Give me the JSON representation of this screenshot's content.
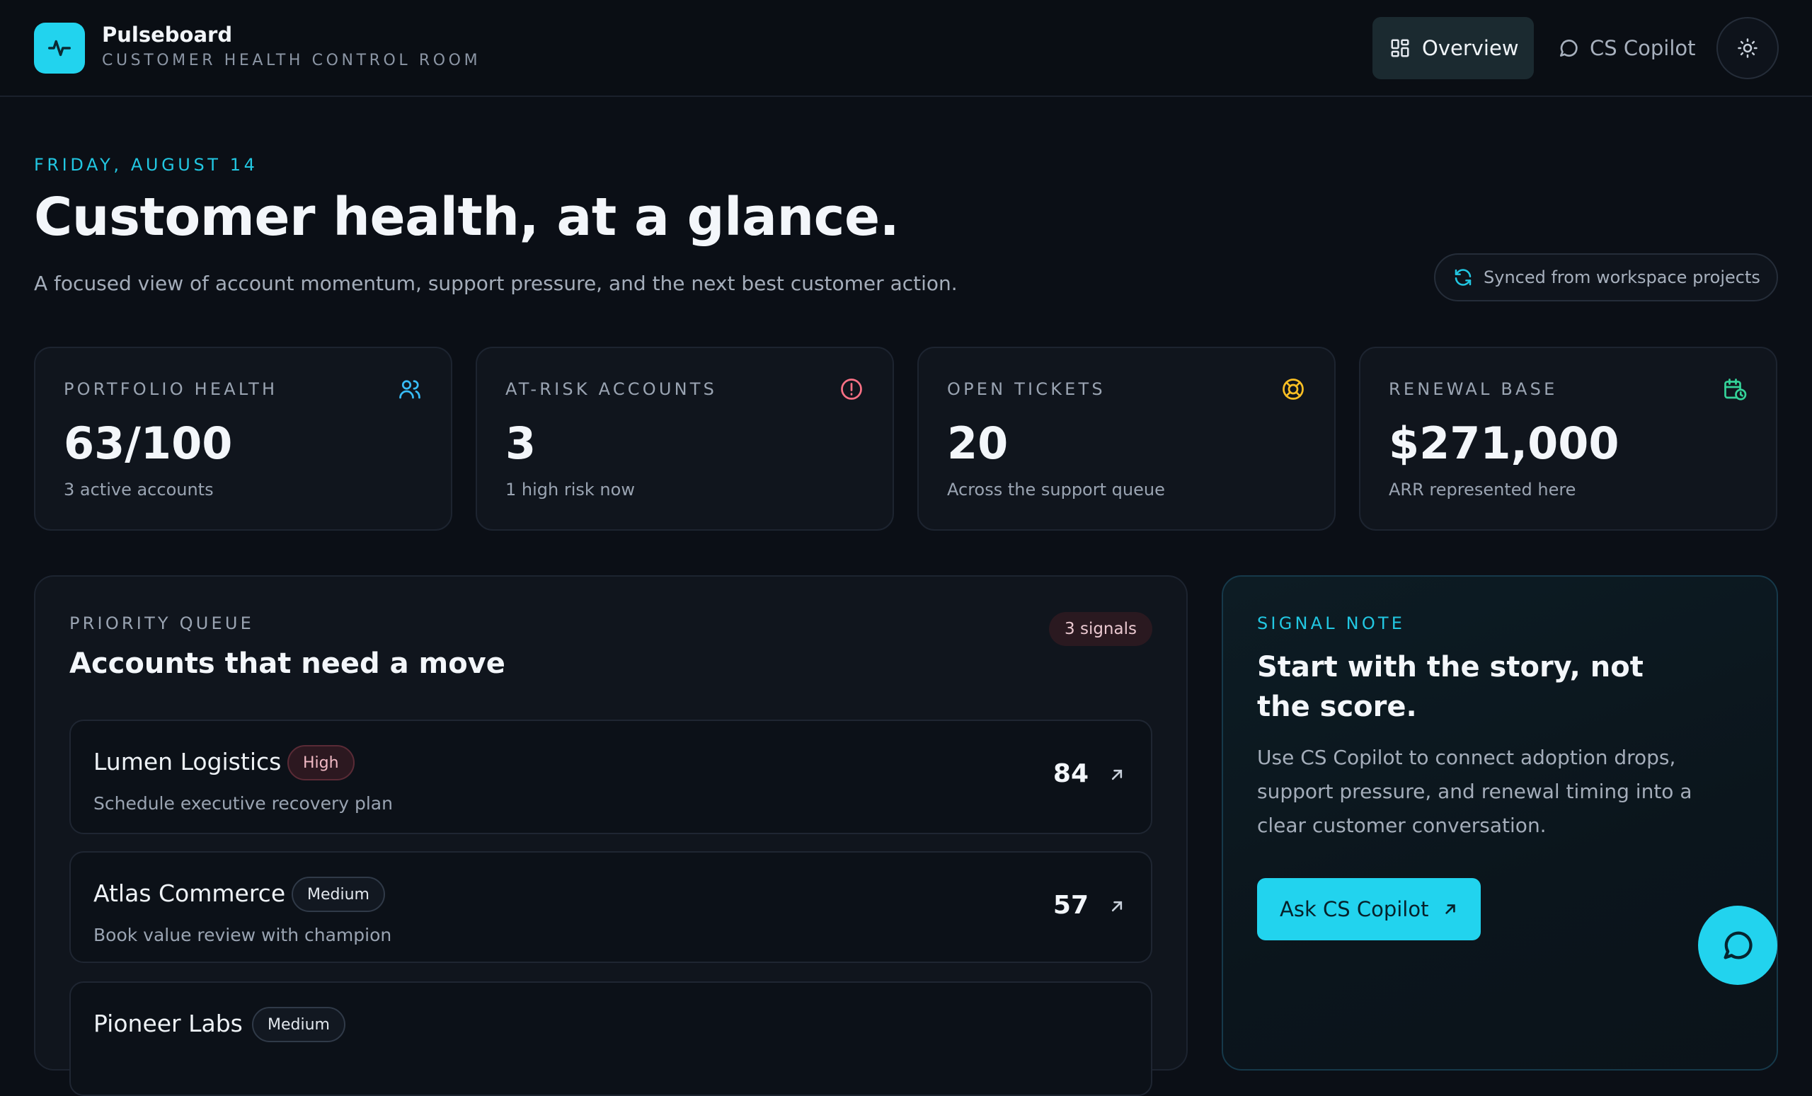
{
  "brand": {
    "name": "Pulseboard",
    "subtitle": "CUSTOMER HEALTH CONTROL ROOM"
  },
  "nav": {
    "overview_label": "Overview",
    "copilot_label": "CS Copilot"
  },
  "hero": {
    "date": "FRIDAY, AUGUST 14",
    "title": "Customer health, at a glance.",
    "subtitle": "A focused view of account momentum, support pressure, and the next best customer action.",
    "sync_label": "Synced from workspace projects"
  },
  "stats": [
    {
      "label": "PORTFOLIO HEALTH",
      "value": "63/100",
      "note": "3 active accounts",
      "icon": "users-icon",
      "color": "#38bdf8"
    },
    {
      "label": "AT-RISK ACCOUNTS",
      "value": "3",
      "note": "1 high risk now",
      "icon": "alert-circle-icon",
      "color": "#fb7185"
    },
    {
      "label": "OPEN TICKETS",
      "value": "20",
      "note": "Across the support queue",
      "icon": "lifebuoy-icon",
      "color": "#fbbf24"
    },
    {
      "label": "RENEWAL BASE",
      "value": "$271,000",
      "note": "ARR represented here",
      "icon": "calendar-clock-icon",
      "color": "#34d399"
    }
  ],
  "queue": {
    "eyebrow": "PRIORITY QUEUE",
    "title": "Accounts that need a move",
    "badge": "3 signals",
    "accounts": [
      {
        "name": "Lumen Logistics",
        "risk": "High",
        "action": "Schedule executive recovery plan",
        "score": "84"
      },
      {
        "name": "Atlas Commerce",
        "risk": "Medium",
        "action": "Book value review with champion",
        "score": "57"
      },
      {
        "name": "Pioneer Labs",
        "risk": "Medium",
        "action": "",
        "score": ""
      }
    ]
  },
  "signal": {
    "eyebrow": "SIGNAL NOTE",
    "title": "Start with the story, not the score.",
    "body": "Use CS Copilot to connect adoption drops, support pressure, and renewal timing into a clear customer conversation.",
    "button_label": "Ask CS Copilot"
  },
  "colors": {
    "accent": "#22d3ee",
    "background": "#0b0f16",
    "high_risk": "#f0b9c4"
  }
}
